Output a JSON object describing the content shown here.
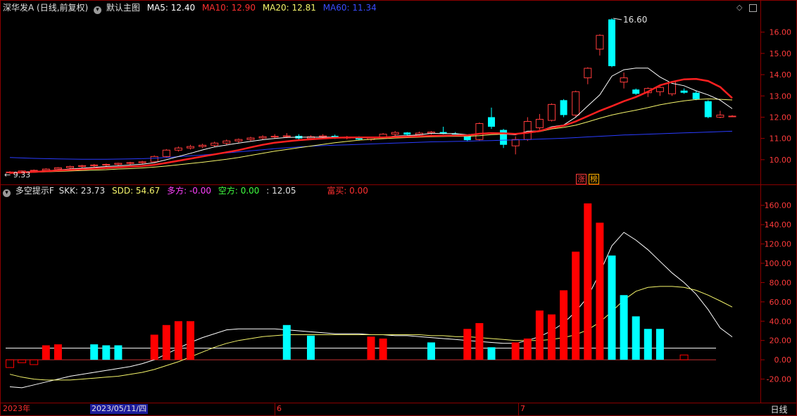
{
  "colors": {
    "background": "#000000",
    "up_candle": "#ff3b3b",
    "down_candle": "#00ffff",
    "grid_red": "#8b0000",
    "ma5": "#ffffff",
    "ma10": "#ff2020",
    "ma20": "#f5f56b",
    "ma60": "#2a3cff",
    "bar_up": "#ff0000",
    "bar_down": "#00ffff"
  },
  "header": {
    "stock_title": "深华发A (日线,前复权)",
    "template_label": "默认主图",
    "ma5": "MA5: 12.40",
    "ma10": "MA10: 12.90",
    "ma20": "MA20: 12.81",
    "ma60": "MA60: 11.34"
  },
  "indicator_header": {
    "name": "多空提示F",
    "skk": "SKK: 23.73",
    "sdd": "SDD: 54.67",
    "duofang": "多方: -0.00",
    "kongfang": "空方: 0.00",
    "value": ": 12.05",
    "fumai": "富买: 0.00"
  },
  "tags": [
    "涨",
    "榜"
  ],
  "footer": {
    "year_label": "2023年",
    "cursor_date": "2023/05/11/四",
    "month_6": "6",
    "month_7": "7",
    "period_button": "日线"
  },
  "chart_data": [
    {
      "type": "candlestick",
      "title": "深华发A (日线,前复权)",
      "y_axis_ticks": [
        "16.00",
        "15.00",
        "14.00",
        "13.00",
        "12.00",
        "11.00",
        "10.00"
      ],
      "ylim": [
        9.3,
        16.85
      ],
      "annotations": [
        {
          "label": "16.60"
        },
        {
          "label": "9.33"
        }
      ],
      "candles": [
        [
          9.38,
          9.46,
          9.33,
          9.42
        ],
        [
          9.42,
          9.5,
          9.38,
          9.47
        ],
        [
          9.47,
          9.54,
          9.42,
          9.5
        ],
        [
          9.5,
          9.6,
          9.46,
          9.56
        ],
        [
          9.56,
          9.65,
          9.52,
          9.62
        ],
        [
          9.62,
          9.72,
          9.58,
          9.68
        ],
        [
          9.68,
          9.76,
          9.62,
          9.72
        ],
        [
          9.72,
          9.8,
          9.66,
          9.75
        ],
        [
          9.75,
          9.82,
          9.68,
          9.78
        ],
        [
          9.78,
          9.86,
          9.72,
          9.83
        ],
        [
          9.83,
          9.9,
          9.76,
          9.86
        ],
        [
          9.86,
          9.95,
          9.8,
          9.9
        ],
        [
          9.9,
          10.2,
          9.85,
          10.15
        ],
        [
          10.15,
          10.5,
          10.1,
          10.45
        ],
        [
          10.45,
          10.62,
          10.38,
          10.55
        ],
        [
          10.55,
          10.7,
          10.48,
          10.62
        ],
        [
          10.62,
          10.75,
          10.55,
          10.68
        ],
        [
          10.68,
          10.85,
          10.6,
          10.78
        ],
        [
          10.78,
          10.95,
          10.7,
          10.88
        ],
        [
          10.88,
          11.0,
          10.8,
          10.95
        ],
        [
          10.95,
          11.08,
          10.88,
          11.02
        ],
        [
          11.02,
          11.15,
          10.95,
          11.08
        ],
        [
          11.08,
          11.2,
          11.0,
          11.1
        ],
        [
          11.1,
          11.25,
          11.02,
          11.12
        ],
        [
          11.12,
          11.2,
          10.95,
          11.0
        ],
        [
          11.0,
          11.15,
          10.92,
          11.08
        ],
        [
          11.08,
          11.2,
          11.0,
          11.12
        ],
        [
          11.12,
          11.18,
          10.98,
          11.02
        ],
        [
          11.02,
          11.12,
          10.95,
          11.05
        ],
        [
          11.05,
          11.1,
          10.9,
          10.95
        ],
        [
          10.95,
          11.08,
          10.88,
          11.02
        ],
        [
          11.02,
          11.25,
          10.98,
          11.2
        ],
        [
          11.2,
          11.35,
          11.1,
          11.28
        ],
        [
          11.28,
          11.3,
          11.15,
          11.18
        ],
        [
          11.18,
          11.32,
          11.1,
          11.25
        ],
        [
          11.25,
          11.35,
          11.18,
          11.3
        ],
        [
          11.3,
          11.55,
          11.2,
          11.22
        ],
        [
          11.22,
          11.3,
          11.1,
          11.18
        ],
        [
          11.1,
          11.15,
          10.85,
          10.92
        ],
        [
          10.95,
          11.75,
          10.9,
          11.7
        ],
        [
          12.0,
          12.45,
          11.45,
          11.55
        ],
        [
          11.4,
          11.45,
          10.55,
          10.7
        ],
        [
          10.65,
          11.1,
          10.25,
          10.95
        ],
        [
          10.95,
          12.0,
          10.88,
          11.8
        ],
        [
          11.5,
          12.15,
          11.4,
          11.9
        ],
        [
          11.85,
          12.65,
          11.8,
          12.6
        ],
        [
          12.8,
          12.85,
          12.0,
          12.1
        ],
        [
          12.1,
          13.25,
          12.0,
          13.2
        ],
        [
          13.85,
          14.35,
          13.55,
          14.3
        ],
        [
          15.2,
          15.9,
          14.9,
          15.85
        ],
        [
          16.6,
          16.65,
          14.35,
          14.4
        ],
        [
          13.65,
          14.1,
          13.35,
          13.85
        ],
        [
          13.3,
          13.35,
          13.05,
          13.1
        ],
        [
          13.15,
          13.4,
          12.95,
          13.35
        ],
        [
          13.2,
          13.45,
          13.0,
          13.4
        ],
        [
          13.1,
          13.7,
          13.0,
          13.65
        ],
        [
          13.25,
          13.35,
          13.1,
          13.15
        ],
        [
          13.15,
          13.25,
          12.8,
          12.85
        ],
        [
          12.75,
          12.8,
          11.95,
          12.0
        ],
        [
          12.0,
          12.3,
          11.95,
          12.1
        ],
        [
          12.05,
          12.1,
          12.03,
          12.05
        ]
      ],
      "ma5": [
        9.38,
        9.41,
        9.45,
        9.48,
        9.52,
        9.56,
        9.6,
        9.64,
        9.68,
        9.71,
        9.75,
        9.79,
        9.86,
        10.0,
        10.15,
        10.3,
        10.46,
        10.6,
        10.69,
        10.78,
        10.86,
        10.94,
        11.0,
        11.05,
        11.06,
        11.06,
        11.06,
        11.06,
        11.05,
        11.04,
        11.03,
        11.05,
        11.11,
        11.13,
        11.17,
        11.24,
        11.23,
        11.23,
        11.17,
        11.23,
        11.27,
        11.21,
        11.17,
        11.34,
        11.35,
        11.55,
        11.63,
        12.0,
        12.53,
        13.05,
        13.93,
        14.23,
        14.31,
        14.31,
        13.89,
        13.59,
        13.48,
        13.24,
        13.05,
        12.8,
        12.4
      ],
      "ma10": [
        9.38,
        9.4,
        9.43,
        9.46,
        9.49,
        9.52,
        9.55,
        9.58,
        9.61,
        9.64,
        9.67,
        9.7,
        9.76,
        9.85,
        9.95,
        10.05,
        10.15,
        10.25,
        10.35,
        10.45,
        10.58,
        10.7,
        10.8,
        10.86,
        10.92,
        10.96,
        11.0,
        11.03,
        11.05,
        11.05,
        11.05,
        11.05,
        11.07,
        11.08,
        11.1,
        11.12,
        11.13,
        11.14,
        11.14,
        11.22,
        11.25,
        11.24,
        11.21,
        11.27,
        11.35,
        11.5,
        11.6,
        11.8,
        12.05,
        12.3,
        12.52,
        12.75,
        12.95,
        13.2,
        13.5,
        13.66,
        13.78,
        13.8,
        13.7,
        13.42,
        12.9
      ],
      "ma20": [
        9.38,
        9.39,
        9.41,
        9.43,
        9.45,
        9.47,
        9.49,
        9.51,
        9.53,
        9.56,
        9.58,
        9.61,
        9.65,
        9.7,
        9.76,
        9.82,
        9.88,
        9.95,
        10.02,
        10.1,
        10.2,
        10.3,
        10.4,
        10.48,
        10.56,
        10.64,
        10.72,
        10.8,
        10.86,
        10.92,
        10.96,
        10.99,
        11.02,
        11.04,
        11.06,
        11.08,
        11.09,
        11.1,
        11.1,
        11.13,
        11.18,
        11.2,
        11.21,
        11.26,
        11.32,
        11.45,
        11.52,
        11.62,
        11.78,
        11.95,
        12.1,
        12.22,
        12.33,
        12.45,
        12.58,
        12.68,
        12.77,
        12.83,
        12.86,
        12.84,
        12.81
      ],
      "ma60": [
        10.1,
        10.08,
        10.06,
        10.05,
        10.04,
        10.03,
        10.02,
        10.02,
        10.02,
        10.03,
        10.04,
        10.05,
        10.07,
        10.1,
        10.14,
        10.18,
        10.22,
        10.27,
        10.32,
        10.37,
        10.42,
        10.47,
        10.52,
        10.56,
        10.6,
        10.63,
        10.66,
        10.68,
        10.7,
        10.72,
        10.74,
        10.76,
        10.78,
        10.8,
        10.82,
        10.84,
        10.85,
        10.86,
        10.87,
        10.89,
        10.9,
        10.92,
        10.93,
        10.95,
        10.97,
        10.99,
        11.01,
        11.04,
        11.07,
        11.1,
        11.13,
        11.16,
        11.18,
        11.2,
        11.22,
        11.24,
        11.26,
        11.28,
        11.3,
        11.32,
        11.34
      ]
    },
    {
      "type": "bar",
      "title": "多空提示F",
      "y_axis_ticks": [
        "160.00",
        "140.00",
        "120.00",
        "100.00",
        "80.00",
        "60.00",
        "40.00",
        "20.00",
        "0.00",
        "-20.00"
      ],
      "ylim": [
        -40,
        170
      ],
      "reference_line": 12.05,
      "bars": [
        {
          "i": 0,
          "v": -8,
          "c": "up",
          "outline": true
        },
        {
          "i": 1,
          "v": -3,
          "c": "up",
          "outline": true
        },
        {
          "i": 2,
          "v": -5,
          "c": "up",
          "outline": true
        },
        {
          "i": 3,
          "v": 15,
          "c": "up"
        },
        {
          "i": 4,
          "v": 16,
          "c": "up"
        },
        {
          "i": 7,
          "v": 16,
          "c": "down"
        },
        {
          "i": 8,
          "v": 15,
          "c": "down"
        },
        {
          "i": 9,
          "v": 15,
          "c": "down"
        },
        {
          "i": 12,
          "v": 26,
          "c": "up"
        },
        {
          "i": 13,
          "v": 36,
          "c": "up"
        },
        {
          "i": 14,
          "v": 40,
          "c": "up"
        },
        {
          "i": 15,
          "v": 40,
          "c": "up"
        },
        {
          "i": 23,
          "v": 36,
          "c": "down"
        },
        {
          "i": 25,
          "v": 25,
          "c": "down"
        },
        {
          "i": 30,
          "v": 24,
          "c": "up"
        },
        {
          "i": 31,
          "v": 22,
          "c": "up"
        },
        {
          "i": 35,
          "v": 18,
          "c": "down"
        },
        {
          "i": 38,
          "v": 32,
          "c": "up"
        },
        {
          "i": 39,
          "v": 38,
          "c": "up"
        },
        {
          "i": 40,
          "v": 13,
          "c": "down"
        },
        {
          "i": 42,
          "v": 18,
          "c": "up"
        },
        {
          "i": 43,
          "v": 22,
          "c": "up"
        },
        {
          "i": 44,
          "v": 51,
          "c": "up"
        },
        {
          "i": 45,
          "v": 47,
          "c": "up"
        },
        {
          "i": 46,
          "v": 72,
          "c": "up"
        },
        {
          "i": 47,
          "v": 112,
          "c": "up"
        },
        {
          "i": 48,
          "v": 162,
          "c": "up"
        },
        {
          "i": 49,
          "v": 142,
          "c": "up"
        },
        {
          "i": 50,
          "v": 108,
          "c": "down"
        },
        {
          "i": 51,
          "v": 67,
          "c": "down"
        },
        {
          "i": 52,
          "v": 45,
          "c": "down"
        },
        {
          "i": 53,
          "v": 32,
          "c": "down"
        },
        {
          "i": 54,
          "v": 32,
          "c": "down"
        },
        {
          "i": 56,
          "v": 5,
          "c": "up",
          "outline": true
        }
      ],
      "skk": [
        -28,
        -29,
        -26,
        -23,
        -20,
        -17,
        -15,
        -13,
        -11,
        -9,
        -7,
        -4,
        0,
        6,
        12,
        18,
        23,
        27,
        31,
        32,
        32,
        32,
        32,
        31,
        30,
        29,
        28,
        27,
        27,
        27,
        26,
        26,
        25,
        25,
        24,
        23,
        22,
        21,
        20,
        19,
        18,
        17,
        17,
        20,
        24,
        30,
        38,
        50,
        65,
        90,
        118,
        132,
        124,
        114,
        102,
        90,
        80,
        68,
        52,
        33,
        23.73
      ],
      "sdd": [
        -15,
        -18,
        -20,
        -21,
        -21,
        -21,
        -20,
        -19,
        -18,
        -17,
        -15,
        -13,
        -10,
        -6,
        -2,
        3,
        8,
        13,
        17,
        20,
        22,
        24,
        25,
        26,
        26,
        26,
        26,
        26,
        26,
        26,
        26,
        26,
        26,
        26,
        26,
        25,
        25,
        24,
        24,
        23,
        22,
        21,
        20,
        20,
        20,
        21,
        23,
        26,
        31,
        39,
        50,
        62,
        71,
        75,
        76,
        76,
        75,
        72,
        67,
        61,
        54.67
      ]
    }
  ]
}
